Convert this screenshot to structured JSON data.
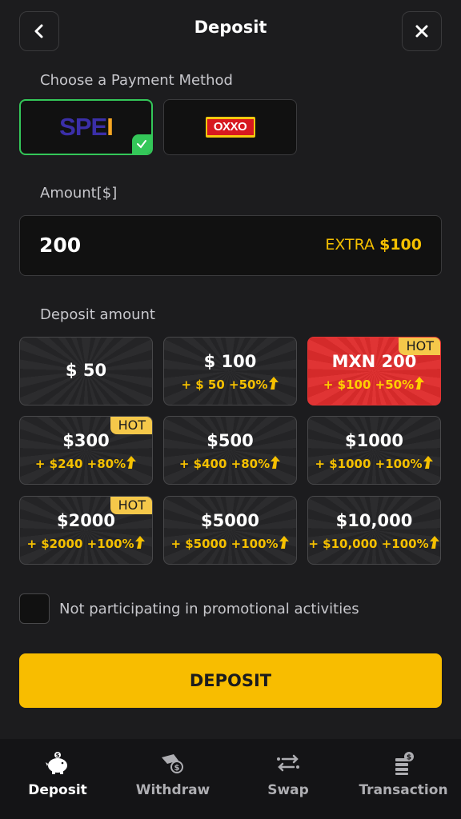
{
  "header": {
    "title": "Deposit"
  },
  "payment": {
    "label": "Choose a Payment Method",
    "methods": [
      {
        "name": "SPEI",
        "logo_text_main": "SPE",
        "logo_text_tail": "I",
        "selected": true
      },
      {
        "name": "OXXO",
        "logo_text": "OXXO",
        "selected": false
      }
    ]
  },
  "amount": {
    "label": "Amount[$]",
    "value": "200",
    "extra_label": "EXTRA",
    "extra_value": "$100"
  },
  "deposit_amount": {
    "label": "Deposit amount",
    "tiles": [
      {
        "amount": "$ 50",
        "bonus": "",
        "badge": ""
      },
      {
        "amount": "$ 100",
        "bonus": "+ $ 50 +50%",
        "badge": ""
      },
      {
        "amount": "MXN 200",
        "bonus": "+ $100  +50%",
        "badge": "HOT"
      },
      {
        "amount": "$300",
        "bonus": "+ $240  +80%",
        "badge": "HOT"
      },
      {
        "amount": "$500",
        "bonus": "+ $400  +80%",
        "badge": ""
      },
      {
        "amount": "$1000",
        "bonus": "+ $1000 +100%",
        "badge": ""
      },
      {
        "amount": "$2000",
        "bonus": "+ $2000 +100%",
        "badge": "HOT"
      },
      {
        "amount": "$5000",
        "bonus": "+ $5000 +100%",
        "badge": ""
      },
      {
        "amount": "$10,000",
        "bonus": "+ $10,000 +100%",
        "badge": ""
      }
    ]
  },
  "promo": {
    "label": "Not participating in promotional activities",
    "checked": false
  },
  "deposit_button": {
    "label": "DEPOSIT"
  },
  "nav": {
    "items": [
      {
        "label": "Deposit",
        "icon": "piggy-bank-icon",
        "active": true
      },
      {
        "label": "Withdraw",
        "icon": "withdraw-hand-icon",
        "active": false
      },
      {
        "label": "Swap",
        "icon": "swap-arrows-icon",
        "active": false
      },
      {
        "label": "Transaction",
        "icon": "transaction-coins-icon",
        "active": false
      }
    ]
  },
  "colors": {
    "accent": "#f8bd00",
    "selected": "#34c759",
    "hot_tile": "#e03434",
    "bonus_text": "#f5c000",
    "background": "#1c1c1e"
  }
}
